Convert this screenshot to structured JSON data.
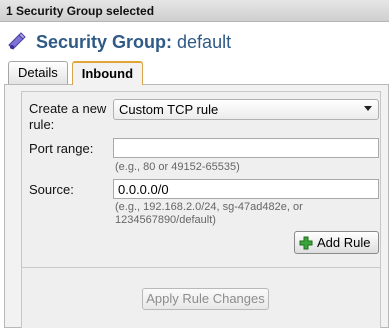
{
  "header": {
    "selection_text": "1 Security Group selected"
  },
  "title": {
    "label": "Security Group:",
    "value": "default"
  },
  "tabs": [
    {
      "label": "Details",
      "active": false
    },
    {
      "label": "Inbound",
      "active": true
    }
  ],
  "form": {
    "create_rule": {
      "label": "Create a new rule:",
      "selected": "Custom TCP rule"
    },
    "port_range": {
      "label": "Port range:",
      "value": "",
      "hint": "(e.g., 80 or 49152-65535)"
    },
    "source": {
      "label": "Source:",
      "value": "0.0.0.0/0",
      "hint": "(e.g., 192.168.2.0/24, sg-47ad482e, or 1234567890/default)"
    },
    "add_rule_label": "Add Rule",
    "apply_label": "Apply Rule Changes"
  },
  "colors": {
    "title": "#2f5a86",
    "tab_accent": "#e1a537",
    "plus": "#3aa63a",
    "icon": "#6b5fc4"
  }
}
